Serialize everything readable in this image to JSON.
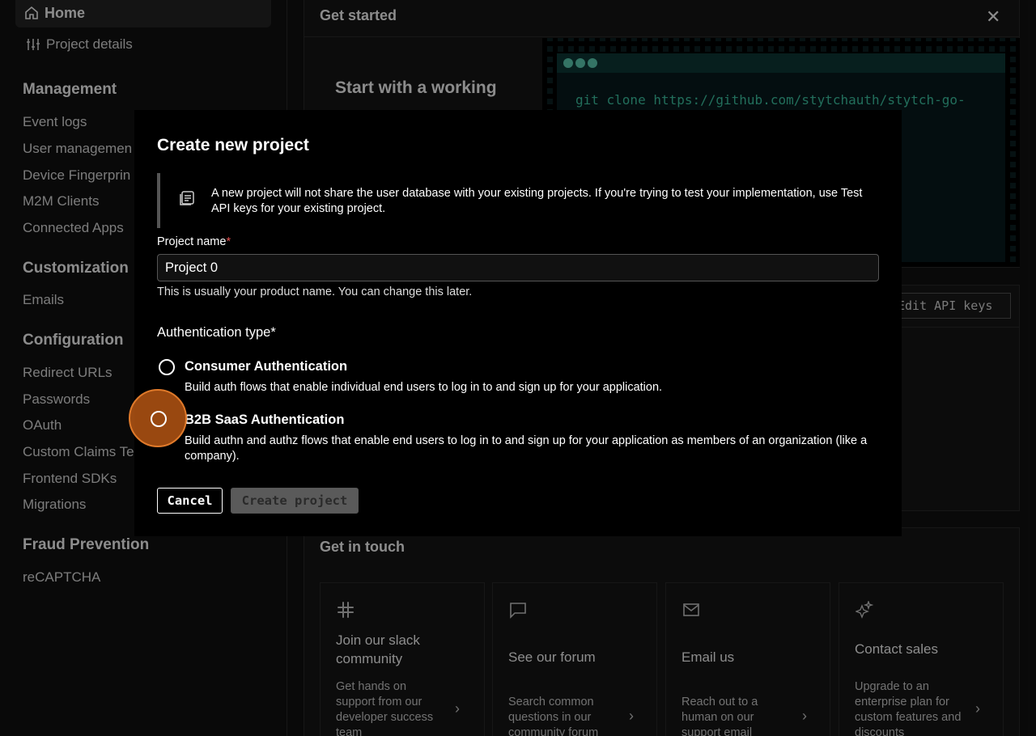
{
  "sidebar": {
    "home": "Home",
    "project_details": "Project details",
    "sections": {
      "management": "Management",
      "customization": "Customization",
      "configuration": "Configuration",
      "fraud_prevention": "Fraud Prevention"
    },
    "management_items": [
      "Event logs",
      "User managemen",
      "Device Fingerprin",
      "M2M Clients",
      "Connected Apps"
    ],
    "customization_items": [
      "Emails"
    ],
    "configuration_items": [
      "Redirect URLs",
      "Passwords",
      "OAuth",
      "Custom Claims Te",
      "Frontend SDKs",
      "Migrations"
    ],
    "fraud_items": [
      "reCAPTCHA"
    ]
  },
  "get_started": {
    "title": "Get started",
    "hero": "Start with a working",
    "code": "git clone https://github.com/stytchauth/stytch-go-",
    "edit_api_keys": "Edit API keys"
  },
  "get_in_touch": {
    "title": "Get in touch",
    "cards": [
      {
        "title": "Join our slack community",
        "desc": "Get hands on support from our developer success team",
        "icon": "slack-icon"
      },
      {
        "title": "See our forum",
        "desc": "Search common questions in our community forum",
        "icon": "chat-bubble-icon"
      },
      {
        "title": "Email us",
        "desc": "Reach out to a human on our support email",
        "icon": "mail-icon"
      },
      {
        "title": "Contact sales",
        "desc": "Upgrade to an enterprise plan for custom features and discounts",
        "icon": "sparkle-icon"
      }
    ]
  },
  "modal": {
    "title": "Create new project",
    "callout": "A new project will not share the user database with your existing projects. If you're trying to test your implementation, use Test API keys for your existing project.",
    "project_name_label": "Project name",
    "required_mark": "*",
    "project_name_value": "Project 0",
    "hint": "This is usually your product name. You can change this later.",
    "auth_type_label": "Authentication type*",
    "options": [
      {
        "title": "Consumer Authentication",
        "desc": "Build auth flows that enable individual end users to log in to and sign up for your application."
      },
      {
        "title": "B2B SaaS Authentication",
        "desc": "Build authn and authz flows that enable end users to log in to and sign up for your application as members of an organization (like a company)."
      }
    ],
    "cancel": "Cancel",
    "create": "Create project"
  },
  "colors": {
    "accent_focus": "#c45c14",
    "code_text": "#3ec9a7",
    "required": "#e05050"
  }
}
